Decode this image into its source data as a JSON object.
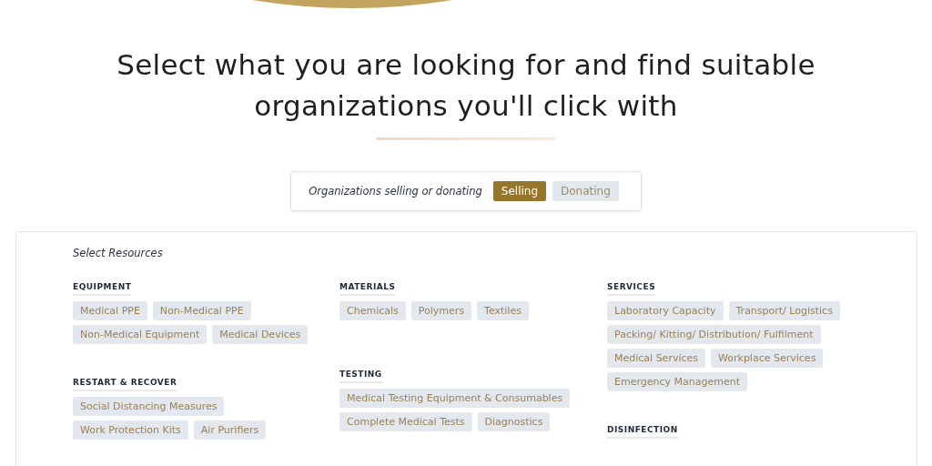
{
  "heading": {
    "title": "Select what you are looking for and find suitable organizations you'll click with"
  },
  "mode_filter": {
    "label": "Organizations selling or donating",
    "options": [
      {
        "label": "Selling",
        "selected": true
      },
      {
        "label": "Donating",
        "selected": false
      }
    ]
  },
  "resources": {
    "title": "Select Resources",
    "columns": [
      {
        "sections": [
          {
            "title": "EQUIPMENT",
            "items": [
              "Medical PPE",
              "Non-Medical PPE",
              "Non-Medical Equipment",
              "Medical Devices"
            ]
          },
          {
            "title": "RESTART & RECOVER",
            "items": [
              "Social Distancing Measures",
              "Work Protection Kits",
              "Air Purifiers"
            ]
          }
        ]
      },
      {
        "sections": [
          {
            "title": "MATERIALS",
            "items": [
              "Chemicals",
              "Polymers",
              "Textiles"
            ]
          },
          {
            "title": "TESTING",
            "items": [
              "Medical Testing Equipment & Consumables",
              "Complete Medical Tests",
              "Diagnostics"
            ]
          }
        ]
      },
      {
        "sections": [
          {
            "title": "SERVICES",
            "items": [
              "Laboratory Capacity",
              "Transport/ Logistics",
              "Packing/ Kitting/ Distribution/ Fulfilment",
              "Medical Services",
              "Workplace Services",
              "Emergency Management"
            ]
          },
          {
            "title": "DISINFECTION"
          }
        ]
      }
    ]
  }
}
